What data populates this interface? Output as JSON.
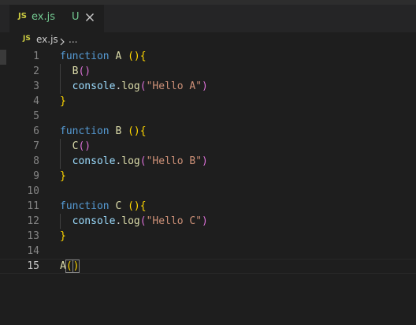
{
  "tab": {
    "icon": "JS",
    "filename": "ex.js",
    "status": "U",
    "close_icon": "close-icon"
  },
  "breadcrumb": {
    "icon": "JS",
    "file": "ex.js",
    "separator_icon": "chevron-right-icon",
    "ellipsis": "..."
  },
  "colors": {
    "keyword": "#569cd6",
    "function": "#dcdcaa",
    "variable": "#9cdcfe",
    "string": "#ce9178",
    "bracket_level1": "#ffd700",
    "bracket_level2": "#da70d6",
    "untracked": "#73c991",
    "js_icon": "#cbcb41"
  },
  "editor": {
    "current_line": "15",
    "lines": [
      {
        "n": "1",
        "tokens": [
          {
            "t": "function",
            "c": "kw"
          },
          {
            "t": " ",
            "c": ""
          },
          {
            "t": "A",
            "c": "fn"
          },
          {
            "t": " ",
            "c": ""
          },
          {
            "t": "()",
            "c": "p1"
          },
          {
            "t": "{",
            "c": "p1"
          }
        ]
      },
      {
        "n": "2",
        "tokens": [
          {
            "t": "  ",
            "c": ""
          },
          {
            "t": "B",
            "c": "fn"
          },
          {
            "t": "()",
            "c": "p2"
          }
        ]
      },
      {
        "n": "3",
        "tokens": [
          {
            "t": "  ",
            "c": ""
          },
          {
            "t": "console",
            "c": "var"
          },
          {
            "t": ".",
            "c": ""
          },
          {
            "t": "log",
            "c": "fn"
          },
          {
            "t": "(",
            "c": "p2"
          },
          {
            "t": "\"Hello A\"",
            "c": "str"
          },
          {
            "t": ")",
            "c": "p2"
          }
        ]
      },
      {
        "n": "4",
        "tokens": [
          {
            "t": "}",
            "c": "p1"
          }
        ]
      },
      {
        "n": "5",
        "tokens": []
      },
      {
        "n": "6",
        "tokens": [
          {
            "t": "function",
            "c": "kw"
          },
          {
            "t": " ",
            "c": ""
          },
          {
            "t": "B",
            "c": "fn"
          },
          {
            "t": " ",
            "c": ""
          },
          {
            "t": "()",
            "c": "p1"
          },
          {
            "t": "{",
            "c": "p1"
          }
        ]
      },
      {
        "n": "7",
        "tokens": [
          {
            "t": "  ",
            "c": ""
          },
          {
            "t": "C",
            "c": "fn"
          },
          {
            "t": "()",
            "c": "p2"
          }
        ]
      },
      {
        "n": "8",
        "tokens": [
          {
            "t": "  ",
            "c": ""
          },
          {
            "t": "console",
            "c": "var"
          },
          {
            "t": ".",
            "c": ""
          },
          {
            "t": "log",
            "c": "fn"
          },
          {
            "t": "(",
            "c": "p2"
          },
          {
            "t": "\"Hello B\"",
            "c": "str"
          },
          {
            "t": ")",
            "c": "p2"
          }
        ]
      },
      {
        "n": "9",
        "tokens": [
          {
            "t": "}",
            "c": "p1"
          }
        ]
      },
      {
        "n": "10",
        "tokens": []
      },
      {
        "n": "11",
        "tokens": [
          {
            "t": "function",
            "c": "kw"
          },
          {
            "t": " ",
            "c": ""
          },
          {
            "t": "C",
            "c": "fn"
          },
          {
            "t": " ",
            "c": ""
          },
          {
            "t": "()",
            "c": "p1"
          },
          {
            "t": "{",
            "c": "p1"
          }
        ]
      },
      {
        "n": "12",
        "tokens": [
          {
            "t": "  ",
            "c": ""
          },
          {
            "t": "console",
            "c": "var"
          },
          {
            "t": ".",
            "c": ""
          },
          {
            "t": "log",
            "c": "fn"
          },
          {
            "t": "(",
            "c": "p2"
          },
          {
            "t": "\"Hello C\"",
            "c": "str"
          },
          {
            "t": ")",
            "c": "p2"
          }
        ]
      },
      {
        "n": "13",
        "tokens": [
          {
            "t": "}",
            "c": "p1"
          }
        ]
      },
      {
        "n": "14",
        "tokens": []
      },
      {
        "n": "15",
        "tokens": [
          {
            "t": "A",
            "c": "fn"
          },
          {
            "t": "(",
            "c": "p1 bm"
          },
          {
            "t": "|",
            "c": "cursor"
          },
          {
            "t": ")",
            "c": "p1 bm"
          }
        ]
      }
    ]
  }
}
